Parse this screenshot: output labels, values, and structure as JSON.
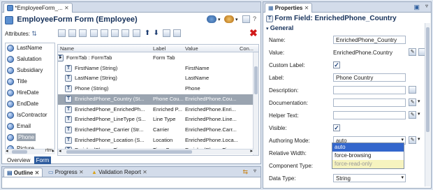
{
  "editor": {
    "tab_label": "*EmployeeForm_...",
    "title": "EmployeeForm Form (Employee)",
    "attributes_label": "Attributes:",
    "attributes": [
      "LastName",
      "Salutation",
      "Subsidiary",
      "Title",
      "HireDate",
      "EndDate",
      "IsContractor",
      "Email",
      "Phone",
      "Picture"
    ],
    "selected_attribute": "Phone",
    "left_scroll_text": "rtm",
    "grid": {
      "columns": [
        "Name",
        "Label",
        "Value",
        "Con..."
      ],
      "rows": [
        {
          "name": "FormTab : FormTab",
          "label": "Form Tab",
          "value": ""
        },
        {
          "name": "FirstName (String)",
          "label": "",
          "value": "FirstName"
        },
        {
          "name": "LastName (String)",
          "label": "",
          "value": "LastName"
        },
        {
          "name": "Phone (String)",
          "label": "",
          "value": "Phone"
        },
        {
          "name": "EnrichedPhone_Country (St...",
          "label": "Phone Cou...",
          "value": "EnrichedPhone.Cou..."
        },
        {
          "name": "EnrichedPhone_EnrichedPh...",
          "label": "Enriched P...",
          "value": "EnrichedPhone.Enri..."
        },
        {
          "name": "EnrichedPhone_LineType (S...",
          "label": "Line Type",
          "value": "EnrichedPhone.Line..."
        },
        {
          "name": "EnrichedPhone_Carrier (Str...",
          "label": "Carrier",
          "value": "EnrichedPhone.Carr..."
        },
        {
          "name": "EnrichedPhone_Location (S...",
          "label": "Location",
          "value": "EnrichedPhone.Loca..."
        },
        {
          "name": "EnrichedPhone_Timezones ...",
          "label": "Time Zones",
          "value": "EnrichedPhone.Tim..."
        }
      ],
      "selected_row": 4
    },
    "bottom_tabs": [
      "Overview",
      "Form"
    ],
    "active_bottom_tab": "Form"
  },
  "views": {
    "tabs": [
      {
        "label": "Outline",
        "active": true
      },
      {
        "label": "Progress",
        "active": false
      },
      {
        "label": "Validation Report",
        "active": false
      }
    ]
  },
  "properties": {
    "tab_label": "Properties",
    "title": "Form Field: EnrichedPhone_Country",
    "section": "General",
    "fields": {
      "name": {
        "label": "Name:",
        "value": "EnrichedPhone_Country"
      },
      "value": {
        "label": "Value:",
        "value": "EnrichedPhone.Country"
      },
      "custom_label": {
        "label": "Custom Label:",
        "checked": true
      },
      "label": {
        "label": "Label:",
        "value": "Phone Country"
      },
      "description": {
        "label": "Description:",
        "value": ""
      },
      "documentation": {
        "label": "Documentation:",
        "value": ""
      },
      "helper_text": {
        "label": "Helper Text:",
        "value": ""
      },
      "visible": {
        "label": "Visible:",
        "checked": true
      },
      "authoring_mode": {
        "label": "Authoring Mode:",
        "value": "auto"
      },
      "relative_width": {
        "label": "Relative Width:",
        "value": ""
      },
      "component_type": {
        "label": "Component Type:",
        "value": ""
      },
      "data_type": {
        "label": "Data Type:",
        "value": "String"
      }
    },
    "authoring_options": [
      "auto",
      "force-browsing",
      "force-read-only"
    ],
    "selected_option": "auto"
  },
  "colors": {
    "selection": "#9aa4b0",
    "dropdown_selection": "#3366cc",
    "hint_bg": "#f6f3bf",
    "delete_red": "#d11a1a"
  }
}
